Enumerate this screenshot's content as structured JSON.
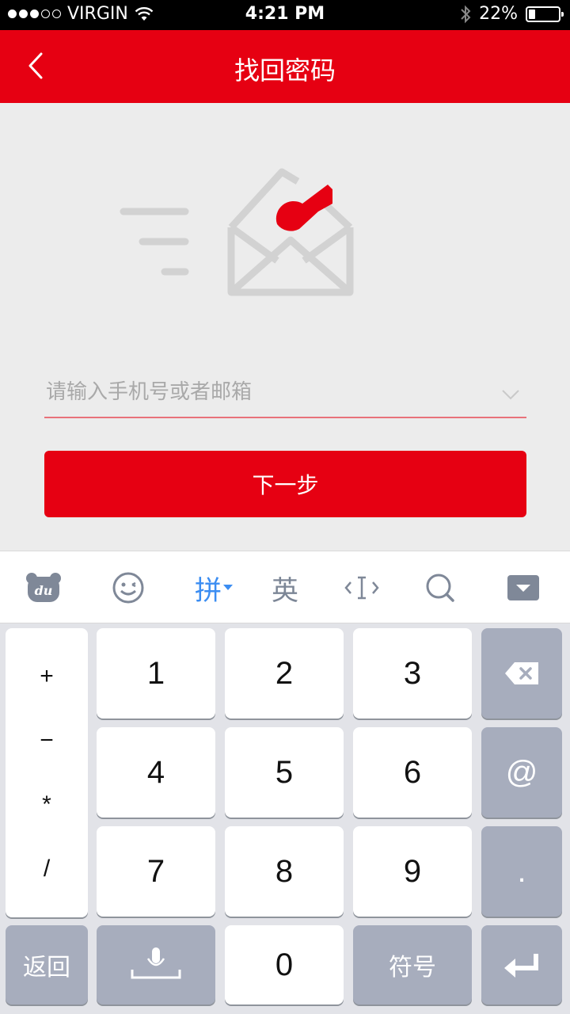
{
  "status": {
    "carrier": "VIRGIN",
    "time": "4:21 PM",
    "battery": "22%",
    "battery_level": 0.22,
    "signal_bars": 3
  },
  "nav": {
    "title": "找回密码",
    "back_icon": "chevron-left-icon"
  },
  "form": {
    "placeholder": "请输入手机号或者邮箱",
    "value": "",
    "next_label": "下一步"
  },
  "colors": {
    "brand_red": "#e60012",
    "keyboard_bg": "#e2e3e8",
    "accent_blue": "#3b8df2"
  },
  "keyboard_toolbar": {
    "items": [
      "du-logo-icon",
      "emoji-icon",
      "拼",
      "英",
      "cursor-icon",
      "search-icon",
      "collapse-keyboard-icon"
    ],
    "pinyin_label": "拼",
    "english_label": "英"
  },
  "keyboard": {
    "side_symbols": [
      "+",
      "−",
      "*",
      "/"
    ],
    "digits": [
      "1",
      "2",
      "3",
      "4",
      "5",
      "6",
      "7",
      "8",
      "9",
      "0"
    ],
    "at": "@",
    "dot": ".",
    "back_label": "返回",
    "symbols_label": "符号"
  }
}
